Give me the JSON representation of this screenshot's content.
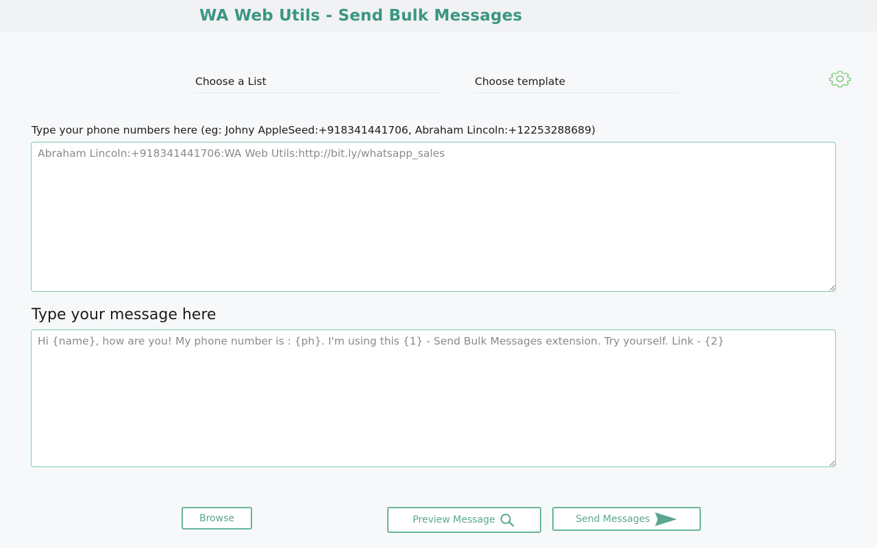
{
  "header": {
    "title": "WA Web Utils - Send Bulk Messages"
  },
  "selectors": {
    "list_label": "Choose a List",
    "template_label": "Choose template"
  },
  "settings": {
    "icon": "gear-icon",
    "color": "#8bd08a"
  },
  "phones": {
    "label": "Type your phone numbers here (eg: Johny AppleSeed:+918341441706, Abraham Lincoln:+12253288689)",
    "placeholder": "Abraham Lincoln:+918341441706:WA Web Utils:http://bit.ly/whatsapp_sales",
    "value": ""
  },
  "message": {
    "label": "Type your message here",
    "placeholder": "Hi {name}, how are you! My phone number is : {ph}. I'm using this {1} - Send Bulk Messages extension. Try yourself. Link - {2}",
    "value": ""
  },
  "actions": {
    "browse_label": "Browse",
    "preview_label": "Preview Message",
    "preview_icon": "search-icon",
    "send_label": "Send Messages",
    "send_icon": "send-icon"
  },
  "colors": {
    "accent": "#3b9682",
    "border": "#7ec7b2",
    "button": "#5aa690"
  }
}
